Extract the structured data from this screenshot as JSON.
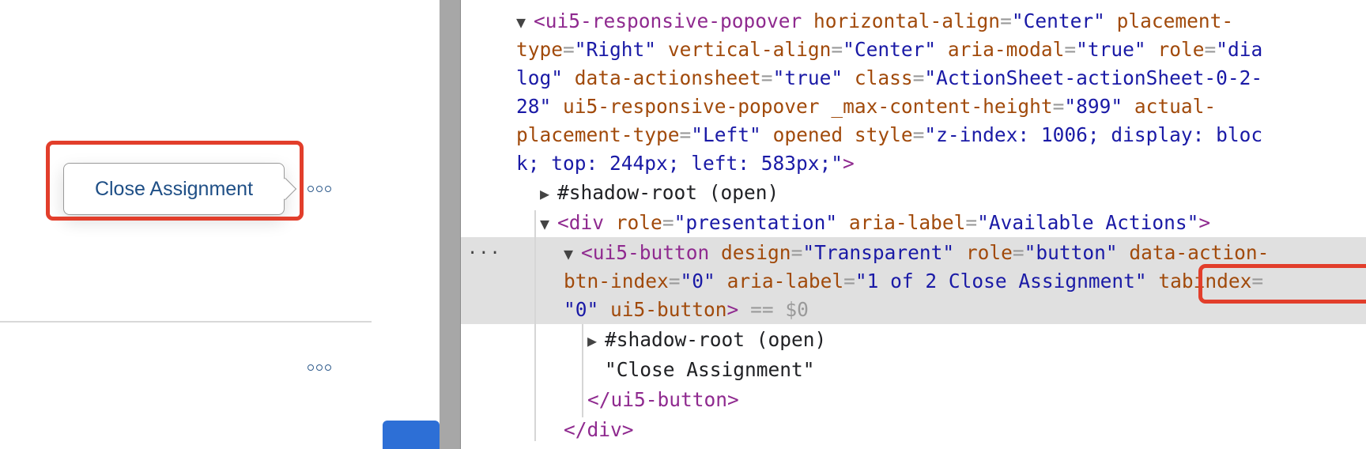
{
  "app": {
    "popover_button_label": "Close Assignment",
    "overflow_icon": "more-horizontal-icon"
  },
  "devtools": {
    "line1": {
      "open": "<",
      "tag": "ui5-responsive-popover",
      "attr1": "horizontal-align",
      "eq": "=",
      "val1": "\"Center\"",
      "attr2_part": "placement-"
    },
    "line2": {
      "attr2_rest": "type",
      "val2": "\"Right\"",
      "attr3": "vertical-align",
      "val3": "\"Center\"",
      "attr4": "aria-modal",
      "val4": "\"true\"",
      "attr5": "role",
      "val5_part": "\"dia"
    },
    "line3": {
      "val5_rest": "log\"",
      "attr6": "data-actionsheet",
      "val6": "\"true\"",
      "attr7": "class",
      "val7_part": "\"ActionSheet-actionSheet-0-2-"
    },
    "line4": {
      "val7_rest": "28\"",
      "attr8": "ui5-responsive-popover",
      "attr9": "_max-content-height",
      "val9": "\"899\"",
      "attr10_part": "actual-"
    },
    "line5": {
      "attr10_rest": "placement-type",
      "val10": "\"Left\"",
      "attr11": "opened",
      "attr12": "style",
      "val12_part": "\"z-index: 1006; display: bloc"
    },
    "line6": {
      "val12_rest": "k; top: 244px; left: 583px;\"",
      "close": ">"
    },
    "shadow_root_1": "#shadow-root (open)",
    "div_line": {
      "open": "<",
      "tag": "div",
      "attr1": "role",
      "val1": "\"presentation\"",
      "attr2": "aria-label",
      "val2": "\"Available Actions\"",
      "close": ">"
    },
    "row_dots": "...",
    "button_line1": {
      "open": "<",
      "tag": "ui5-button",
      "attr1": "design",
      "val1": "\"Transparent\"",
      "attr2": "role",
      "val2": "\"button\"",
      "attr3_part": "data-action-"
    },
    "button_line2": {
      "attr3_rest": "btn-index",
      "val3": "\"0\"",
      "attr4": "aria-label",
      "val4": "\"1 of 2 Close Assignment\"",
      "attr5": "tabindex",
      "eq5": "="
    },
    "button_line3": {
      "val5": "\"0\"",
      "attr6": "ui5-button",
      "close": ">",
      "suffix": "== $0"
    },
    "shadow_root_2": "#shadow-root (open)",
    "text_node": "\"Close Assignment\"",
    "button_close": "</ui5-button>",
    "div_close": "</div>",
    "colors": {
      "tag": "#8f2a8f",
      "attribute": "#a14a0b",
      "value": "#1a1aa6",
      "highlight": "#e23e2b",
      "selected_row": "#e0e0e0"
    }
  }
}
